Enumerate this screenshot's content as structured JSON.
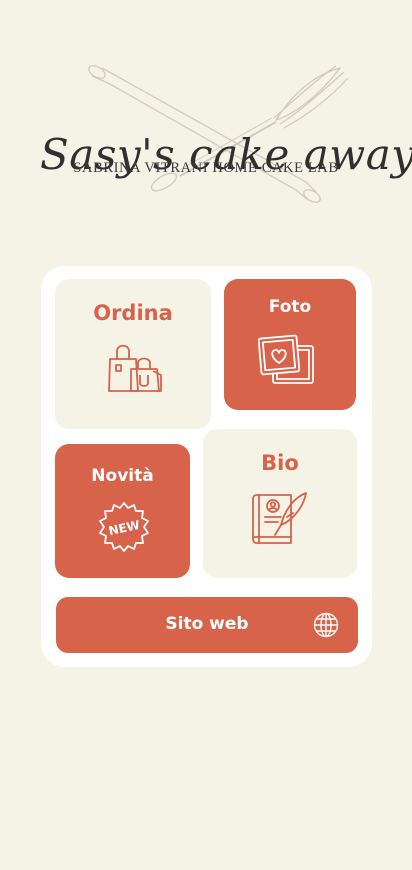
{
  "logo": {
    "title": "Sasy's cake away",
    "subtitle": "SABRINA VITRANI HOME CAKE LAB"
  },
  "menu": {
    "ordina": {
      "label": "Ordina",
      "icon": "shopping-bags-icon"
    },
    "foto": {
      "label": "Foto",
      "icon": "photos-heart-icon"
    },
    "novita": {
      "label": "Novità",
      "icon": "new-badge-icon",
      "badge_text": "NEW"
    },
    "bio": {
      "label": "Bio",
      "icon": "book-quill-icon"
    },
    "sito_web": {
      "label": "Sito web",
      "icon": "globe-icon"
    }
  },
  "colors": {
    "background": "#f5f2e6",
    "accent": "#d6634a",
    "panel": "#ffffff"
  }
}
